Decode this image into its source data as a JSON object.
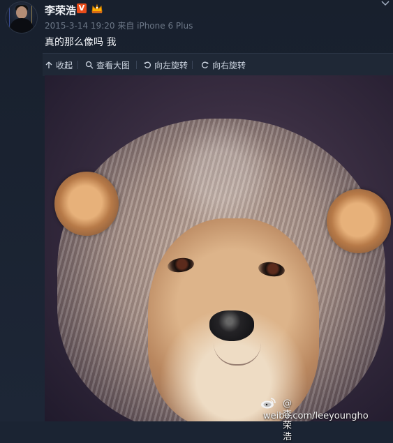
{
  "user": {
    "name": "李荣浩",
    "verified_badge": "V"
  },
  "post": {
    "meta": "2015-3-14 19:20 来自 iPhone 6 Plus",
    "caption": "真的那么像吗 我"
  },
  "toolbar": {
    "collapse": "收起",
    "view_large": "查看大图",
    "rotate_left": "向左旋转",
    "rotate_right": "向右旋转"
  },
  "watermark": {
    "brand": "@李荣浩",
    "site": "weibo.com/leeyoungho"
  },
  "colors": {
    "background": "#1b2433",
    "toolbar_bg": "#1f2836",
    "verified_badge": "#e94c1a",
    "meta_text": "#6c7787"
  },
  "icons": [
    "chevron-down-icon",
    "collapse-icon",
    "search-icon",
    "rotate-left-icon",
    "rotate-right-icon",
    "weibo-logo-icon",
    "crown-icon"
  ]
}
